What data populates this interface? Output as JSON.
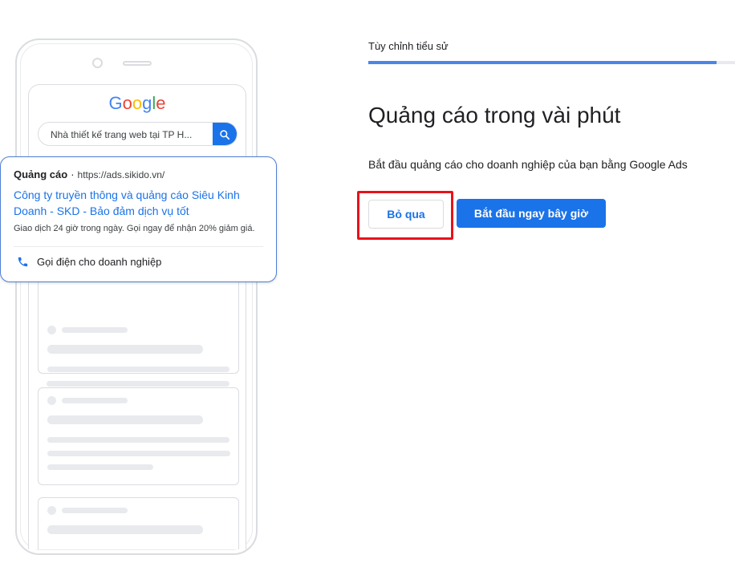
{
  "phone": {
    "logo_letters": [
      "G",
      "o",
      "o",
      "g",
      "l",
      "e"
    ],
    "logo_colors": [
      "#4285F4",
      "#EA4335",
      "#FBBC05",
      "#4285F4",
      "#34A853",
      "#EA4335"
    ],
    "search_text": "Nhà thiết kế trang web tại TP H...",
    "search_icon": "search-icon"
  },
  "ad": {
    "label": "Quảng cáo",
    "separator": "·",
    "url": "https://ads.sikido.vn/",
    "title": "Công ty truyền thông và quảng cáo Siêu Kinh Doanh - SKD - Bảo đảm dịch vụ tốt",
    "description": "Giao dịch 24 giờ trong ngày. Gọi ngay để nhận 20% giảm giá.",
    "call_label": "Gọi điện cho doanh nghiệp",
    "call_icon": "phone-icon"
  },
  "setup": {
    "step_label": "Tùy chỉnh tiểu sử",
    "progress": 0.95,
    "title": "Quảng cáo trong vài phút",
    "subtitle": "Bắt đầu quảng cáo cho doanh nghiệp của bạn bằng Google Ads",
    "skip_label": "Bỏ qua",
    "start_label": "Bắt đầu ngay bây giờ"
  },
  "colors": {
    "accent": "#1a73e8",
    "progress": "#4a86e8",
    "highlight": "#e8121a"
  }
}
